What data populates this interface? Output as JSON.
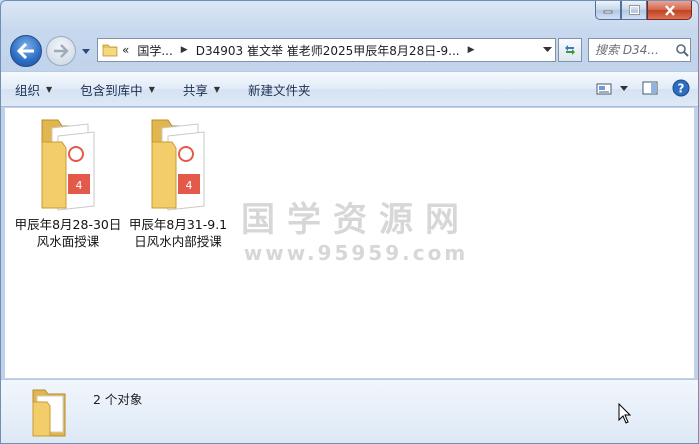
{
  "window": {
    "caption": {
      "minimize": "minimize",
      "maximize": "maximize",
      "close": "close"
    }
  },
  "address": {
    "overflow": "«",
    "crumbs": [
      "国学...",
      "D34903 崔文举 崔老师2025甲辰年8月28日-9..."
    ],
    "search_placeholder": "搜索 D34..."
  },
  "toolbar": {
    "organize": "组织",
    "include_in_library": "包含到库中",
    "share": "共享",
    "new_folder": "新建文件夹"
  },
  "files": [
    {
      "name": "甲辰年8月28-30日风水面授课"
    },
    {
      "name": "甲辰年8月31-9.1日风水内部授课"
    }
  ],
  "watermark": {
    "line1": "国学资源网",
    "line2": "www.95959.com"
  },
  "details": {
    "count": "2 个对象"
  },
  "colors": {
    "accent": "#2b6dc4",
    "folder": "#f2cd6a",
    "pdf": "#e45a4a"
  }
}
